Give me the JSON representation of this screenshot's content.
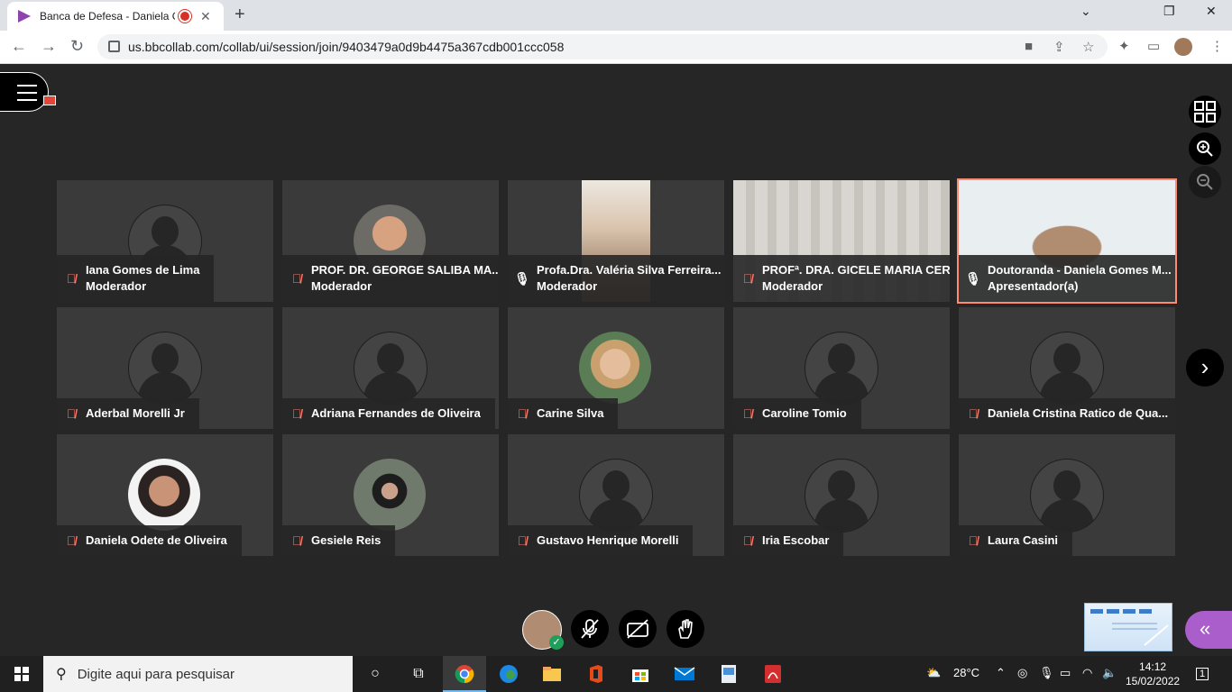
{
  "browser": {
    "tab_title": "Banca de Defesa - Daniela G",
    "tab_close": "✕",
    "new_tab": "+",
    "url": "us.bbcollab.com/collab/ui/session/join/9403479a0d9b4475a367cdb001ccc058",
    "window_controls": [
      "⌄",
      "❐",
      "✕"
    ]
  },
  "participants": [
    {
      "name": "Iana Gomes de Lima",
      "role": "Moderador",
      "muted": true,
      "avatar": "placeholder"
    },
    {
      "name": "PROF. DR. GEORGE SALIBA MA...",
      "role": "Moderador",
      "muted": true,
      "avatar": "photo"
    },
    {
      "name": "Profa.Dra. Valéria Silva Ferreira...",
      "role": "Moderador",
      "muted": false,
      "avatar": "video"
    },
    {
      "name": "PROFª. DRA. GICELE MARIA CER...",
      "role": "Moderador",
      "muted": true,
      "avatar": "video"
    },
    {
      "name": "Doutoranda - Daniela Gomes M...",
      "role": "Apresentador(a)",
      "muted": false,
      "avatar": "video",
      "active": true
    },
    {
      "name": "Aderbal Morelli Jr",
      "role": "",
      "muted": true,
      "avatar": "placeholder"
    },
    {
      "name": "Adriana Fernandes de Oliveira",
      "role": "",
      "muted": true,
      "avatar": "placeholder"
    },
    {
      "name": "Carine Silva",
      "role": "",
      "muted": true,
      "avatar": "photo"
    },
    {
      "name": "Caroline Tomio",
      "role": "",
      "muted": true,
      "avatar": "placeholder"
    },
    {
      "name": "Daniela Cristina Ratico de Qua...",
      "role": "",
      "muted": true,
      "avatar": "placeholder"
    },
    {
      "name": "Daniela Odete de Oliveira",
      "role": "",
      "muted": true,
      "avatar": "photo"
    },
    {
      "name": "Gesiele Reis",
      "role": "",
      "muted": true,
      "avatar": "photo"
    },
    {
      "name": "Gustavo Henrique Morelli",
      "role": "",
      "muted": true,
      "avatar": "placeholder"
    },
    {
      "name": "Iria Escobar",
      "role": "",
      "muted": true,
      "avatar": "placeholder"
    },
    {
      "name": "Laura Casini",
      "role": "",
      "muted": true,
      "avatar": "placeholder"
    }
  ],
  "icons": {
    "mic_muted": "🎙̸",
    "next": "›",
    "collab_panel": "«"
  },
  "taskbar": {
    "search_placeholder": "Digite aqui para pesquisar",
    "weather": "28°C",
    "time": "14:12",
    "date": "15/02/2022",
    "notifications": "1"
  },
  "colors": {
    "active_speaker_border": "#ff8a72",
    "muted_mic": "#ff7a6a",
    "collab_accent": "#a95ecb",
    "status_green": "#1ea05b"
  }
}
